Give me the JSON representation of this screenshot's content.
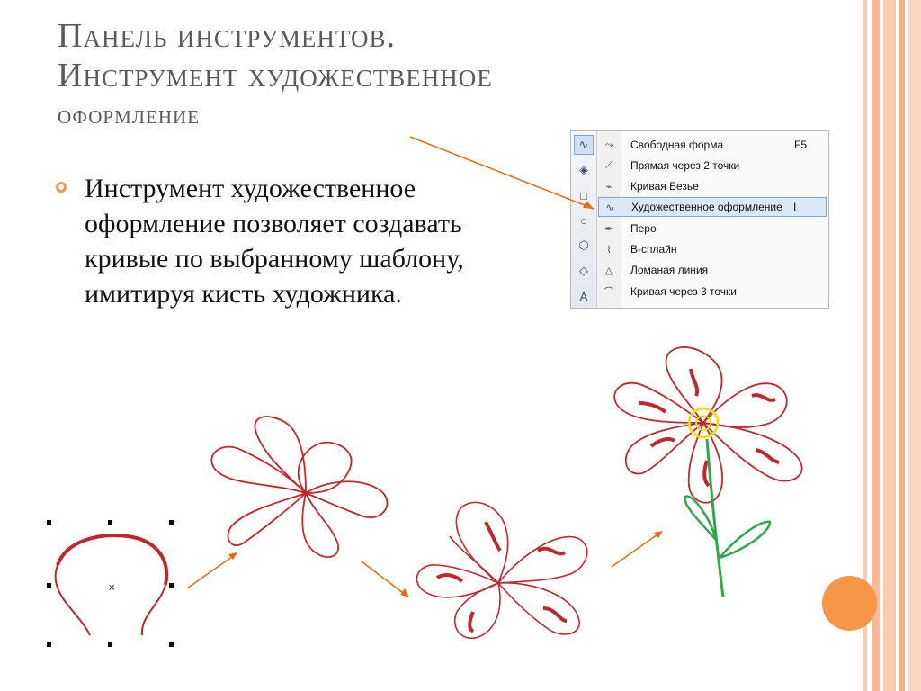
{
  "slide": {
    "title_line1": "Панель инструментов.",
    "title_line2": "Инструмент художественное",
    "title_line3": "оформление",
    "bullet": "Инструмент художественное оформление позволяет создавать кривые по выбранному шаблону, имитируя кисть художника.",
    "accent_color": "#f79646"
  },
  "menu": {
    "items": [
      {
        "label": "Свободная форма",
        "shortcut": "F5",
        "icon": "freehand-icon",
        "highlighted": false
      },
      {
        "label": "Прямая через 2 точки",
        "shortcut": "",
        "icon": "two-point-line-icon",
        "highlighted": false
      },
      {
        "label": "Кривая Безье",
        "shortcut": "",
        "icon": "bezier-icon",
        "highlighted": false
      },
      {
        "label": "Художественное оформление",
        "shortcut": "I",
        "icon": "artistic-media-icon",
        "highlighted": true
      },
      {
        "label": "Перо",
        "shortcut": "",
        "icon": "pen-icon",
        "highlighted": false
      },
      {
        "label": "B-сплайн",
        "shortcut": "",
        "icon": "b-spline-icon",
        "highlighted": false
      },
      {
        "label": "Ломаная линия",
        "shortcut": "",
        "icon": "polyline-icon",
        "highlighted": false
      },
      {
        "label": "Кривая через 3 точки",
        "shortcut": "",
        "icon": "three-point-curve-icon",
        "highlighted": false
      }
    ]
  },
  "toolbar": {
    "buttons": [
      "curve-tool-icon",
      "smart-fill-icon",
      "rectangle-tool-icon",
      "ellipse-tool-icon",
      "polygon-tool-icon",
      "basic-shapes-icon",
      "text-tool-icon"
    ]
  }
}
